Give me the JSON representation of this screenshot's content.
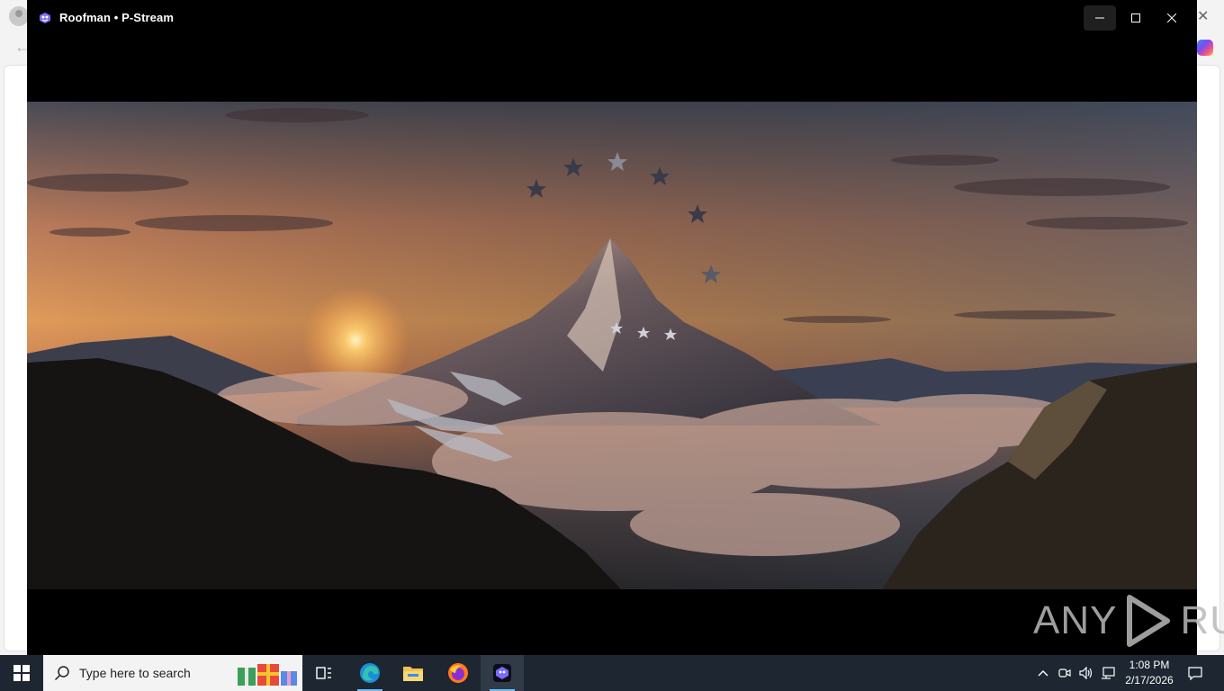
{
  "window": {
    "title": "Roofman • P-Stream",
    "controls": [
      "minimize",
      "maximize",
      "close"
    ]
  },
  "video": {
    "description_icon": "mountain-logo-intro"
  },
  "watermark": {
    "left": "ANY",
    "right": "RUN"
  },
  "taskbar": {
    "search_placeholder": "Type here to search",
    "apps": [
      "task-view-icon",
      "edge-icon",
      "file-explorer-icon",
      "firefox-icon",
      "p-stream-icon"
    ],
    "clock_time": "1:08 PM",
    "clock_date": "2/17/2026"
  },
  "colors": {
    "taskbar_bg": "#1d2631",
    "window_bg": "#000000",
    "accent": "#76b9ed"
  }
}
